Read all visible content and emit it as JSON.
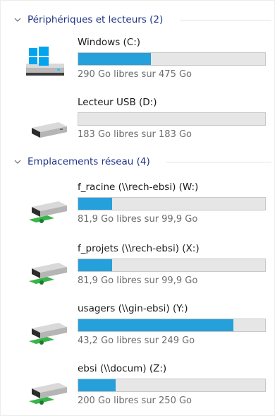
{
  "groups": [
    {
      "label": "Périphériques et lecteurs (2)"
    },
    {
      "label": "Emplacements réseau (4)"
    }
  ],
  "drives": [
    {
      "name": "Windows (C:)",
      "space": "290 Go libres sur 475 Go",
      "used_fraction": 0.39,
      "icon": "windows-drive-icon"
    },
    {
      "name": "Lecteur USB (D:)",
      "space": "183 Go libres sur 183 Go",
      "used_fraction": 0.0,
      "icon": "usb-drive-icon"
    },
    {
      "name": "f_racine (\\\\rech-ebsi) (W:)",
      "space": "81,9 Go libres sur 99,9 Go",
      "used_fraction": 0.18,
      "icon": "network-drive-icon"
    },
    {
      "name": "f_projets (\\\\rech-ebsi) (X:)",
      "space": "81,9 Go libres sur 99,9 Go",
      "used_fraction": 0.18,
      "icon": "network-drive-icon"
    },
    {
      "name": "usagers (\\\\gin-ebsi) (Y:)",
      "space": "43,2 Go libres sur 249 Go",
      "used_fraction": 0.83,
      "icon": "network-drive-icon"
    },
    {
      "name": "ebsi (\\\\docum) (Z:)",
      "space": "200 Go libres sur 250 Go",
      "used_fraction": 0.2,
      "icon": "network-drive-icon"
    }
  ],
  "colors": {
    "bar_fill": "#26a0da",
    "bar_track": "#e6e6e6",
    "group_header": "#1e3287"
  }
}
